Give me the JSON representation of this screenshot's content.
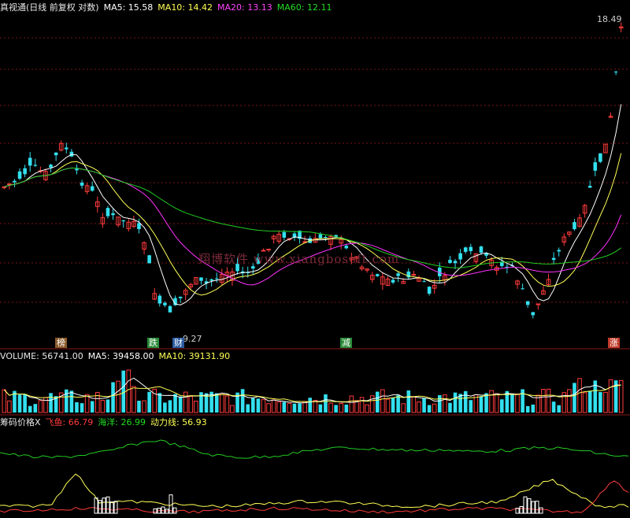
{
  "main_header": {
    "title": "真视通(日线 前复权 对数)",
    "ma5": "MA5: 15.58",
    "ma10": "MA10: 14.42",
    "ma20": "MA20: 13.13",
    "ma60": "MA60: 12.11"
  },
  "price_high_label": "18.49",
  "price_low_label": "9.27",
  "badges": [
    {
      "text": "榜"
    },
    {
      "text": "跌"
    },
    {
      "text": "财"
    },
    {
      "text": "减"
    },
    {
      "text": "涨"
    }
  ],
  "watermark": "翔博软件 www.xiangbosoft.com",
  "volume_header": {
    "volume": "VOLUME: 56741.00",
    "ma5": "MA5: 39458.00",
    "ma10": "MA10: 39131.90"
  },
  "indicator_header": {
    "name": "筹码价格X",
    "feiyu": "飞鱼: 66.79",
    "haiyang": "海洋: 26.99",
    "dongli": "动力线: 56.93"
  },
  "colors": {
    "up": "#ff3b3b",
    "down": "#33e0ef",
    "ma5": "#ffffff",
    "ma10": "#ffff55",
    "ma20": "#ff33ff",
    "ma60": "#22cc22",
    "grid": "#7a1414"
  },
  "chart_data": {
    "type": "candlestick",
    "x": [],
    "close": [],
    "volume": [],
    "series": []
  }
}
